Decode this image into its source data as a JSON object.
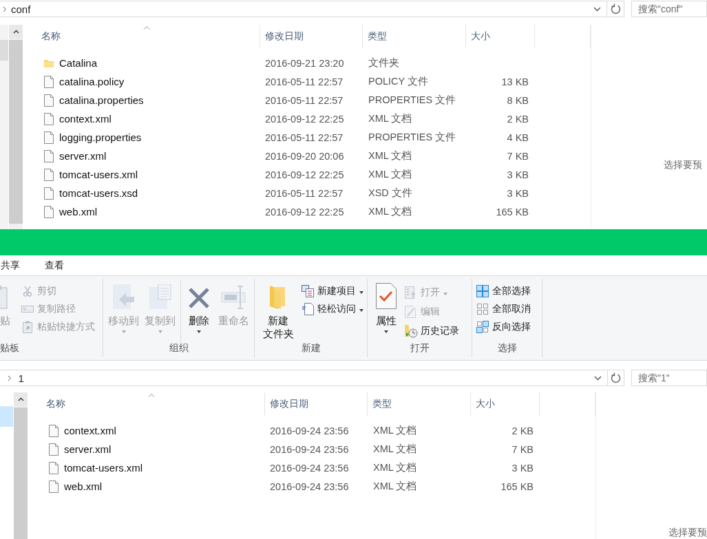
{
  "top_window": {
    "address": {
      "path": "conf"
    },
    "search": {
      "placeholder": "搜索\"conf\""
    },
    "columns": [
      "名称",
      "修改日期",
      "类型",
      "大小"
    ],
    "files": [
      {
        "kind": "folder",
        "name": "Catalina",
        "modified": "2016-09-21 23:20",
        "type": "文件夹"
      },
      {
        "kind": "file",
        "name": "catalina.policy",
        "modified": "2016-05-11 22:57",
        "type": "POLICY 文件",
        "size": "13 KB"
      },
      {
        "kind": "file",
        "name": "catalina.properties",
        "modified": "2016-05-11 22:57",
        "type": "PROPERTIES 文件",
        "size": "8 KB"
      },
      {
        "kind": "file",
        "name": "context.xml",
        "modified": "2016-09-12 22:25",
        "type": "XML 文档",
        "size": "2 KB"
      },
      {
        "kind": "file",
        "name": "logging.properties",
        "modified": "2016-05-11 22:57",
        "type": "PROPERTIES 文件",
        "size": "4 KB"
      },
      {
        "kind": "file",
        "name": "server.xml",
        "modified": "2016-09-20 20:06",
        "type": "XML 文档",
        "size": "7 KB"
      },
      {
        "kind": "file",
        "name": "tomcat-users.xml",
        "modified": "2016-09-12 22:25",
        "type": "XML 文档",
        "size": "3 KB"
      },
      {
        "kind": "file",
        "name": "tomcat-users.xsd",
        "modified": "2016-05-11 22:57",
        "type": "XSD 文件",
        "size": "3 KB"
      },
      {
        "kind": "file",
        "name": "web.xml",
        "modified": "2016-09-12 22:25",
        "type": "XML 文档",
        "size": "165 KB"
      }
    ],
    "preview": "选择要预"
  },
  "bottom_window": {
    "ribbon_tabs": [
      {
        "label": "共享",
        "selected": false
      },
      {
        "label": "查看",
        "selected": false
      }
    ],
    "ribbon": {
      "groups": [
        {
          "label": "贴板",
          "items": [
            {
              "kind": "large",
              "label": "贴",
              "disabled": true,
              "dropdown": false
            },
            {
              "kind": "small",
              "label": "剪切",
              "disabled": true,
              "dropdown": false
            },
            {
              "kind": "small",
              "label": "复制路径",
              "disabled": true,
              "dropdown": false
            },
            {
              "kind": "small",
              "label": "粘贴快捷方式",
              "disabled": true,
              "dropdown": false
            }
          ]
        },
        {
          "label": "组织",
          "items": [
            {
              "kind": "large",
              "label": "移动到",
              "disabled": true,
              "dropdown": true
            },
            {
              "kind": "large",
              "label": "复制到",
              "disabled": true,
              "dropdown": true
            },
            {
              "kind": "large",
              "label": "删除",
              "disabled": false,
              "dropdown": true
            },
            {
              "kind": "large",
              "label": "重命名",
              "disabled": true,
              "dropdown": false
            }
          ]
        },
        {
          "label": "新建",
          "items": [
            {
              "kind": "large",
              "label": "新建文件夹",
              "disabled": false,
              "dropdown": false
            },
            {
              "kind": "small",
              "label": "新建项目",
              "disabled": false,
              "dropdown": true
            },
            {
              "kind": "small",
              "label": "轻松访问",
              "disabled": false,
              "dropdown": true
            }
          ]
        },
        {
          "label": "打开",
          "items": [
            {
              "kind": "large",
              "label": "属性",
              "disabled": false,
              "dropdown": true
            },
            {
              "kind": "small",
              "label": "打开",
              "disabled": true,
              "dropdown": true
            },
            {
              "kind": "small",
              "label": "编辑",
              "disabled": true,
              "dropdown": false
            },
            {
              "kind": "small",
              "label": "历史记录",
              "disabled": false,
              "dropdown": false
            }
          ]
        },
        {
          "label": "选择",
          "items": [
            {
              "kind": "small",
              "label": "全部选择",
              "disabled": false,
              "dropdown": false
            },
            {
              "kind": "small",
              "label": "全部取消",
              "disabled": false,
              "dropdown": false
            },
            {
              "kind": "small",
              "label": "反向选择",
              "disabled": false,
              "dropdown": false
            }
          ]
        }
      ]
    },
    "address": {
      "path": "1"
    },
    "search": {
      "placeholder": "搜索\"1\""
    },
    "columns": [
      "名称",
      "修改日期",
      "类型",
      "大小"
    ],
    "files": [
      {
        "kind": "file",
        "name": "context.xml",
        "modified": "2016-09-24 23:56",
        "type": "XML 文档",
        "size": "2 KB"
      },
      {
        "kind": "file",
        "name": "server.xml",
        "modified": "2016-09-24 23:56",
        "type": "XML 文档",
        "size": "7 KB"
      },
      {
        "kind": "file",
        "name": "tomcat-users.xml",
        "modified": "2016-09-24 23:56",
        "type": "XML 文档",
        "size": "3 KB"
      },
      {
        "kind": "file",
        "name": "web.xml",
        "modified": "2016-09-24 23:56",
        "type": "XML 文档",
        "size": "165 KB"
      }
    ],
    "preview": "选择要预"
  }
}
